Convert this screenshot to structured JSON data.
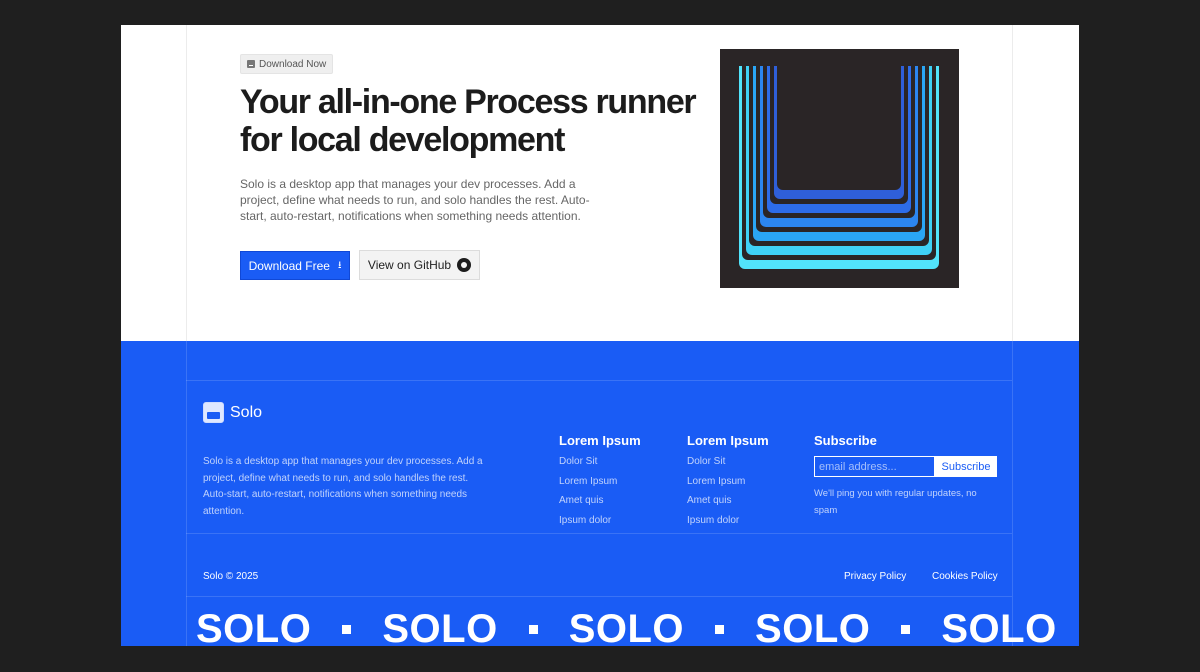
{
  "hero": {
    "badge": "Download Now",
    "title": "Your all-in-one Process runner for local development",
    "description": "Solo is a desktop app that manages your dev processes. Add a project, define what needs to run, and solo handles the rest. Auto-start, auto-restart, notifications when something needs attention.",
    "primary_button": "Download Free",
    "secondary_button": "View on GitHub",
    "art_colors": [
      "#2f5fd9",
      "#2d6ce8",
      "#2c86f0",
      "#2aa6f5",
      "#3fd1f6",
      "#52e4fb"
    ]
  },
  "footer": {
    "brand": {
      "name": "Solo",
      "description": "Solo is a desktop app that manages your dev processes. Add a project, define what needs to run, and solo handles the rest. Auto-start, auto-restart, notifications when something needs attention."
    },
    "columns": [
      {
        "heading": "Lorem Ipsum",
        "links": [
          "Dolor Sit",
          "Lorem Ipsum",
          "Amet quis",
          "Ipsum dolor"
        ]
      },
      {
        "heading": "Lorem Ipsum",
        "links": [
          "Dolor Sit",
          "Lorem Ipsum",
          "Amet quis",
          "Ipsum dolor"
        ]
      }
    ],
    "subscribe": {
      "heading": "Subscribe",
      "placeholder": "email address...",
      "button": "Subscribe",
      "note": "We'll ping you with regular updates, no spam"
    },
    "copyright": "Solo © 2025",
    "legal": [
      "Privacy Policy",
      "Cookies Policy"
    ],
    "marquee": [
      "SOLO",
      "SOLO",
      "SOLO",
      "SOLO",
      "SOLO"
    ]
  },
  "colors": {
    "accent": "#1a5cf5",
    "page_bg": "#1f1f1f",
    "art_bg": "#2a2526"
  }
}
